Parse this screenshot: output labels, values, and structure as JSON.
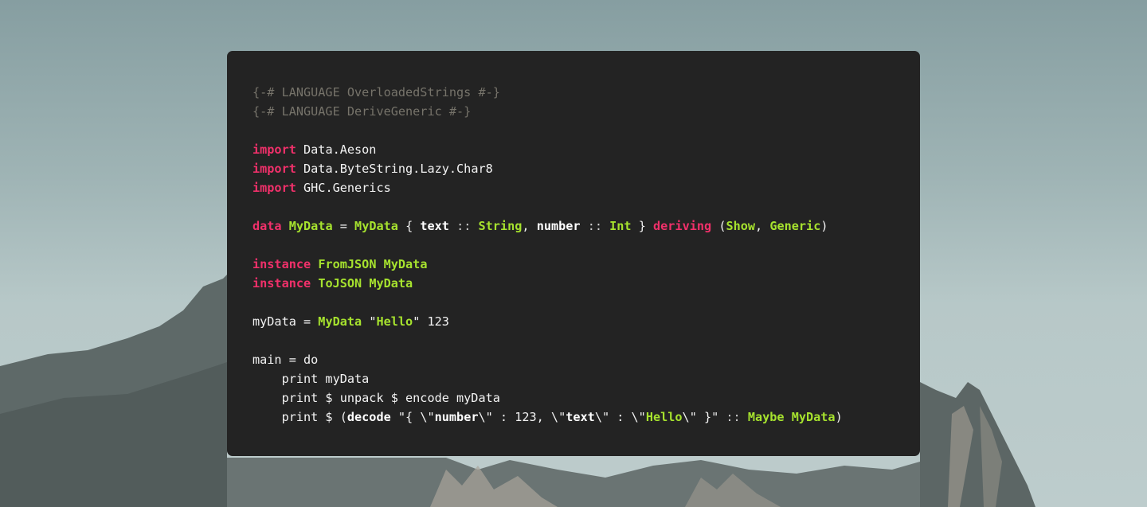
{
  "colors": {
    "card_bg": "#232323",
    "comment": "#76736a",
    "keyword": "#f0306a",
    "type": "#a6e22e",
    "text": "#f3f3f3"
  },
  "code": {
    "lines": [
      [
        {
          "t": "{-# LANGUAGE OverloadedStrings #-}",
          "c": "cm"
        }
      ],
      [
        {
          "t": "{-# LANGUAGE DeriveGeneric #-}",
          "c": "cm"
        }
      ],
      [],
      [
        {
          "t": "import",
          "c": "kw"
        },
        {
          "t": " Data.Aeson",
          "c": ""
        }
      ],
      [
        {
          "t": "import",
          "c": "kw"
        },
        {
          "t": " Data.ByteString.Lazy.Char8",
          "c": ""
        }
      ],
      [
        {
          "t": "import",
          "c": "kw"
        },
        {
          "t": " GHC.Generics",
          "c": ""
        }
      ],
      [],
      [
        {
          "t": "data",
          "c": "kw"
        },
        {
          "t": " ",
          "c": ""
        },
        {
          "t": "MyData",
          "c": "ty"
        },
        {
          "t": " = ",
          "c": ""
        },
        {
          "t": "MyData",
          "c": "ty"
        },
        {
          "t": " { ",
          "c": ""
        },
        {
          "t": "text",
          "c": "fd"
        },
        {
          "t": " :: ",
          "c": "op"
        },
        {
          "t": "String",
          "c": "ty"
        },
        {
          "t": ", ",
          "c": ""
        },
        {
          "t": "number",
          "c": "fd"
        },
        {
          "t": " :: ",
          "c": "op"
        },
        {
          "t": "Int",
          "c": "ty"
        },
        {
          "t": " } ",
          "c": ""
        },
        {
          "t": "deriving",
          "c": "kw"
        },
        {
          "t": " (",
          "c": ""
        },
        {
          "t": "Show",
          "c": "ty"
        },
        {
          "t": ", ",
          "c": ""
        },
        {
          "t": "Generic",
          "c": "ty"
        },
        {
          "t": ")",
          "c": ""
        }
      ],
      [],
      [
        {
          "t": "instance",
          "c": "kw"
        },
        {
          "t": " ",
          "c": ""
        },
        {
          "t": "FromJSON MyData",
          "c": "ty"
        }
      ],
      [
        {
          "t": "instance",
          "c": "kw"
        },
        {
          "t": " ",
          "c": ""
        },
        {
          "t": "ToJSON MyData",
          "c": "ty"
        }
      ],
      [],
      [
        {
          "t": "myData = ",
          "c": ""
        },
        {
          "t": "MyData",
          "c": "ty"
        },
        {
          "t": " \"",
          "c": ""
        },
        {
          "t": "Hello",
          "c": "ty"
        },
        {
          "t": "\" 123",
          "c": ""
        }
      ],
      [],
      [
        {
          "t": "main = do",
          "c": ""
        }
      ],
      [
        {
          "t": "    print myData",
          "c": ""
        }
      ],
      [
        {
          "t": "    print $ unpack $ encode myData",
          "c": ""
        }
      ],
      [
        {
          "t": "    print $ (",
          "c": ""
        },
        {
          "t": "decode",
          "c": "fd"
        },
        {
          "t": " \"{ \\\"",
          "c": ""
        },
        {
          "t": "number",
          "c": "fd"
        },
        {
          "t": "\\\" : 123, \\\"",
          "c": ""
        },
        {
          "t": "text",
          "c": "fd"
        },
        {
          "t": "\\\" : \\\"",
          "c": ""
        },
        {
          "t": "Hello",
          "c": "ty"
        },
        {
          "t": "\\\" }\"",
          "c": ""
        },
        {
          "t": " :: ",
          "c": "op"
        },
        {
          "t": "Maybe MyData",
          "c": "ty"
        },
        {
          "t": ")",
          "c": ""
        }
      ]
    ]
  }
}
